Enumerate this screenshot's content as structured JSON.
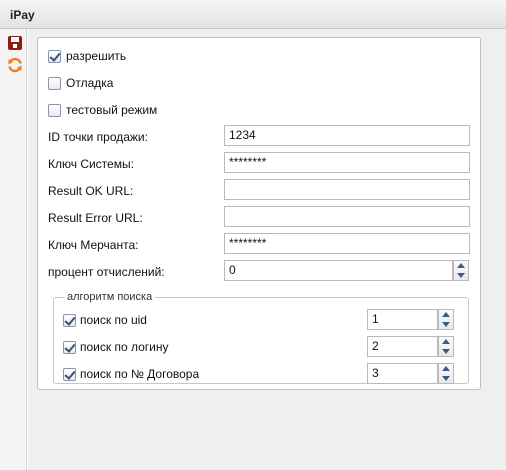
{
  "window": {
    "title": "iPay"
  },
  "toolbar": {
    "save_icon": "save-icon",
    "refresh_icon": "refresh-icon"
  },
  "form": {
    "enable": {
      "label": "разрешить",
      "checked": true
    },
    "debug": {
      "label": "Отладка",
      "checked": false
    },
    "test_mode": {
      "label": "тестовый режим",
      "checked": false
    },
    "sale_point_id": {
      "label": "ID точки продажи:",
      "value": "1234"
    },
    "system_key": {
      "label": "Ключ Системы:",
      "value": "********"
    },
    "result_ok_url": {
      "label": "Result OK URL:",
      "value": ""
    },
    "result_error_url": {
      "label": "Result Error URL:",
      "value": ""
    },
    "merchant_key": {
      "label": "Ключ Мерчанта:",
      "value": "********"
    },
    "deduction_percent": {
      "label": "процент отчислений:",
      "value": "0"
    }
  },
  "search_algorithm": {
    "legend": "алгоритм поиска",
    "by_uid": {
      "label": "поиск по uid",
      "checked": true,
      "order": "1"
    },
    "by_login": {
      "label": "поиск по логину",
      "checked": true,
      "order": "2"
    },
    "by_contract": {
      "label": "поиск по № Договора",
      "checked": true,
      "order": "3"
    }
  },
  "colors": {
    "accent_save": "#8a1c14",
    "accent_refresh": "#f07b1e",
    "spinner_arrow": "#3b5b8c"
  }
}
